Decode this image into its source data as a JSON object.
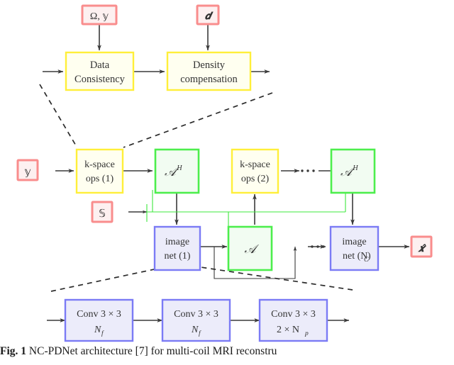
{
  "figure": {
    "caption_prefix": "Fig. 1",
    "caption_text": "NC-PDNet architecture [7] for multi-coil MRI reconstru"
  },
  "colors": {
    "yellow_border": "#ffef3a",
    "yellow_fill": "#fffff0",
    "green_border": "#4dee4d",
    "green_fill": "#f2fcf2",
    "blue_border": "#7b7bf5",
    "blue_fill": "#ececfa",
    "red_border": "#f98d8d",
    "red_fill": "#fdf0f0",
    "arrow": "#3a3a3a",
    "sensitivity_line": "#3ce83c",
    "dashed": "#2b2b2b"
  },
  "rows": {
    "top": {
      "name": "top-row",
      "inputs": [
        {
          "id": "omega-y",
          "label": "Ω, 𝕪"
        },
        {
          "id": "d",
          "label": "𝒅"
        }
      ],
      "blocks": [
        {
          "id": "data-consistency",
          "line1": "Data",
          "line2": "Consistency"
        },
        {
          "id": "density-compensation",
          "line1": "Density",
          "line2": "compensation"
        }
      ]
    },
    "middle": {
      "name": "middle-row",
      "inputs": [
        {
          "id": "y-input",
          "label": "𝕪"
        },
        {
          "id": "s-input",
          "label": "𝕊"
        }
      ],
      "outputs": [
        {
          "id": "x-hat",
          "label": "𝒙̂"
        }
      ],
      "blocks": [
        {
          "id": "kspace-ops-1",
          "line1": "k-space",
          "line2": "ops (1)"
        },
        {
          "id": "adjoint-op-1",
          "line1": "𝒜",
          "sup": "H"
        },
        {
          "id": "kspace-ops-2",
          "line1": "k-space",
          "line2": "ops (2)"
        },
        {
          "id": "adjoint-op-2",
          "line1": "𝒜",
          "sup": "H"
        },
        {
          "id": "image-net-1",
          "line1": "image",
          "line2": "net (1)"
        },
        {
          "id": "forward-op",
          "line1": "𝒜"
        },
        {
          "id": "image-net-nc",
          "line1": "image",
          "line2": "net (N",
          "sub": "C",
          "line2b": ")"
        }
      ],
      "ellipsis": "⋯"
    },
    "bottom": {
      "name": "bottom-row",
      "blocks": [
        {
          "id": "conv-1",
          "line1": "Conv 3 × 3",
          "line2": "N",
          "sub": "f"
        },
        {
          "id": "conv-2",
          "line1": "Conv 3 × 3",
          "line2": "N",
          "sub": "f"
        },
        {
          "id": "conv-3",
          "line1": "Conv 3 × 3",
          "line2": "2 × N",
          "sub": "p"
        }
      ]
    }
  }
}
